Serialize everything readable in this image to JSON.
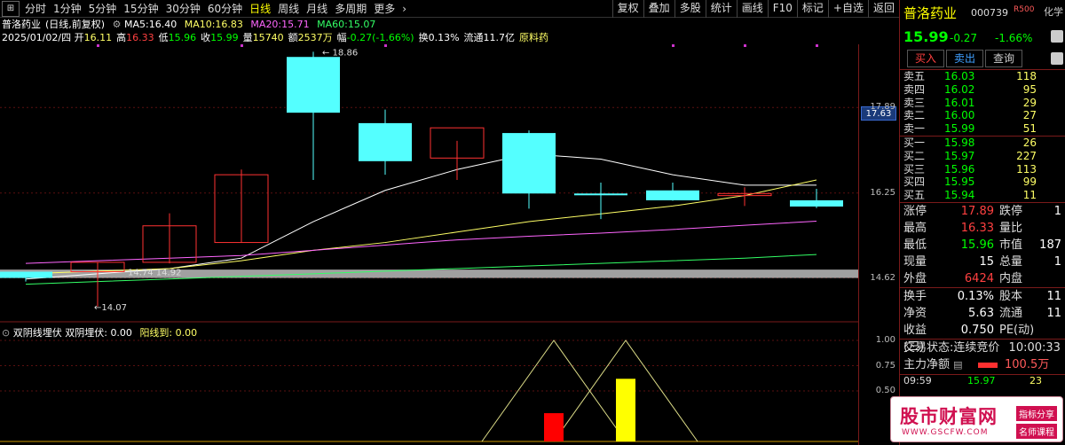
{
  "toolbar": {
    "periods": [
      "分时",
      "1分钟",
      "5分钟",
      "15分钟",
      "30分钟",
      "60分钟",
      "日线",
      "周线",
      "月线",
      "多周期",
      "更多"
    ],
    "active_period": "日线",
    "more_icon": "chevron-right-icon",
    "right_buttons": [
      "复权",
      "叠加",
      "多股",
      "统计",
      "画线",
      "F10",
      "标记",
      "+自选",
      "返回"
    ]
  },
  "header": {
    "stock_name": "普洛药业",
    "adjust": "(日线,前复权)",
    "ma5_label": "MA5:",
    "ma5": "16.40",
    "ma10_label": "MA10:",
    "ma10": "16.83",
    "ma20_label": "MA20:",
    "ma20": "15.71",
    "ma60_label": "MA60:",
    "ma60": "15.07",
    "date": "2025/01/02/四",
    "open_label": "开",
    "open": "16.11",
    "high_label": "高",
    "high": "16.33",
    "low_label": "低",
    "low": "15.96",
    "close_label": "收",
    "close": "15.99",
    "volume_label": "量",
    "volume": "15740",
    "amount_label": "额",
    "amount": "2537万",
    "change_label": "幅",
    "change": "-0.27(-1.66%)",
    "turnover_label": "换",
    "turnover": "0.13%",
    "float_label": "流通",
    "float": "11.7亿",
    "sector": "原料药",
    "gear_icon": "gear-icon"
  },
  "chart_data": [
    {
      "type": "candlestick",
      "title": "",
      "annotations": {
        "high": "18.86",
        "low": "14.07",
        "mid_left": "14.74",
        "mid_right": "14.92"
      },
      "ylim": [
        14.0,
        19.0
      ],
      "y_ticks": [
        "17.89",
        "16.25",
        "14.62"
      ],
      "current_price_tag": "17.63",
      "candles": [
        {
          "o": 14.62,
          "h": 14.74,
          "l": 14.55,
          "c": 14.74,
          "color": "cyan"
        },
        {
          "o": 14.74,
          "h": 14.92,
          "l": 14.07,
          "c": 14.92,
          "color": "red"
        },
        {
          "o": 14.92,
          "h": 15.86,
          "l": 14.9,
          "c": 15.62,
          "color": "red"
        },
        {
          "o": 15.3,
          "h": 16.7,
          "l": 15.3,
          "c": 16.6,
          "color": "red"
        },
        {
          "o": 18.86,
          "h": 18.96,
          "l": 16.5,
          "c": 17.79,
          "color": "cyan"
        },
        {
          "o": 17.59,
          "h": 17.85,
          "l": 16.6,
          "c": 16.86,
          "color": "cyan"
        },
        {
          "o": 16.92,
          "h": 17.25,
          "l": 16.5,
          "c": 17.5,
          "color": "red"
        },
        {
          "o": 17.4,
          "h": 17.45,
          "l": 15.95,
          "c": 16.24,
          "color": "cyan"
        },
        {
          "o": 16.24,
          "h": 16.45,
          "l": 15.75,
          "c": 16.24,
          "color": "cyan"
        },
        {
          "o": 16.3,
          "h": 16.45,
          "l": 16.1,
          "c": 16.11,
          "color": "cyan"
        },
        {
          "o": 16.24,
          "h": 16.36,
          "l": 16.0,
          "c": 16.2,
          "color": "red"
        },
        {
          "o": 16.11,
          "h": 16.33,
          "l": 15.96,
          "c": 15.99,
          "color": "cyan"
        }
      ],
      "series": [
        {
          "name": "MA5",
          "values": [
            14.6,
            14.7,
            14.8,
            15.0,
            15.7,
            16.3,
            16.7,
            17.0,
            16.9,
            16.6,
            16.4,
            16.4
          ]
        },
        {
          "name": "MA10",
          "values": [
            14.7,
            14.75,
            14.8,
            14.95,
            15.15,
            15.3,
            15.5,
            15.7,
            15.85,
            16.0,
            16.2,
            16.5
          ]
        },
        {
          "name": "MA20",
          "values": [
            14.9,
            14.95,
            15.0,
            15.05,
            15.15,
            15.25,
            15.35,
            15.42,
            15.48,
            15.55,
            15.63,
            15.71
          ]
        },
        {
          "name": "MA60",
          "values": [
            14.5,
            14.55,
            14.6,
            14.65,
            14.7,
            14.75,
            14.8,
            14.85,
            14.9,
            14.95,
            15.0,
            15.07
          ]
        }
      ]
    },
    {
      "type": "bar",
      "title": "双阴线埋伏",
      "label1": "双阴埋伏:",
      "val1": "0.00",
      "label2": "阳线到:",
      "val2": "0.00",
      "ylim": [
        0,
        1.0
      ],
      "y_ticks": [
        "1.00",
        "0.75",
        "0.50"
      ],
      "bars": [
        {
          "index": 7,
          "value": 0.28,
          "color": "#ff0000"
        },
        {
          "index": 8,
          "value": 0.62,
          "color": "#ffff00"
        }
      ],
      "triangles": [
        {
          "start": 6,
          "peak": 7,
          "end": 8,
          "peak_value": 1.0
        },
        {
          "start": 7,
          "peak": 8,
          "end": 9,
          "peak_value": 1.0
        }
      ]
    }
  ],
  "panel": {
    "name": "普洛药业",
    "code": "000739",
    "r_mark": "R500",
    "icon": "hua-icon",
    "icon_text": "化学",
    "price": "15.99",
    "change": "-0.27",
    "pct": "-1.66%",
    "buttons": [
      "买入",
      "卖出",
      "查询"
    ],
    "sell": [
      {
        "label": "卖五",
        "price": "16.03",
        "vol": "118"
      },
      {
        "label": "卖四",
        "price": "16.02",
        "vol": "95"
      },
      {
        "label": "卖三",
        "price": "16.01",
        "vol": "29"
      },
      {
        "label": "卖二",
        "price": "16.00",
        "vol": "27"
      },
      {
        "label": "卖一",
        "price": "15.99",
        "vol": "51"
      }
    ],
    "buy": [
      {
        "label": "买一",
        "price": "15.98",
        "vol": "26"
      },
      {
        "label": "买二",
        "price": "15.97",
        "vol": "227"
      },
      {
        "label": "买三",
        "price": "15.96",
        "vol": "113"
      },
      {
        "label": "买四",
        "price": "15.95",
        "vol": "99"
      },
      {
        "label": "买五",
        "price": "15.94",
        "vol": "11"
      }
    ],
    "stats": [
      {
        "l": "涨停",
        "v": "17.89",
        "vc": "red",
        "l2": "跌停",
        "v2": "1"
      },
      {
        "l": "最高",
        "v": "16.33",
        "vc": "red",
        "l2": "量比",
        "v2": ""
      },
      {
        "l": "最低",
        "v": "15.96",
        "vc": "green",
        "l2": "市值",
        "v2": "187"
      },
      {
        "l": "现量",
        "v": "15",
        "vc": "white",
        "l2": "总量",
        "v2": "1"
      },
      {
        "l": "外盘",
        "v": "6424",
        "vc": "red",
        "l2": "内盘",
        "v2": ""
      }
    ],
    "stats2": [
      {
        "l": "换手",
        "v": "0.13%",
        "l2": "股本",
        "v2": "11"
      },
      {
        "l": "净资",
        "v": "5.63",
        "l2": "流通",
        "v2": "11"
      },
      {
        "l": "收益(三)",
        "v": "0.750",
        "l2": "PE(动)",
        "v2": ""
      }
    ],
    "trade_status_label": "交易状态:",
    "trade_status": "连续竞价",
    "trade_time": "10:00:33",
    "flow_label": "主力净额",
    "flow_icon": "info-icon",
    "flow_value": "100.5万",
    "tick_time": "09:59",
    "tick_price": "15.97",
    "tick_vol": "23"
  },
  "watermark": {
    "logo": "股市财富网",
    "url": "WWW.GSCFW.COM",
    "tag1": "指标分享",
    "tag2": "名师课程"
  }
}
